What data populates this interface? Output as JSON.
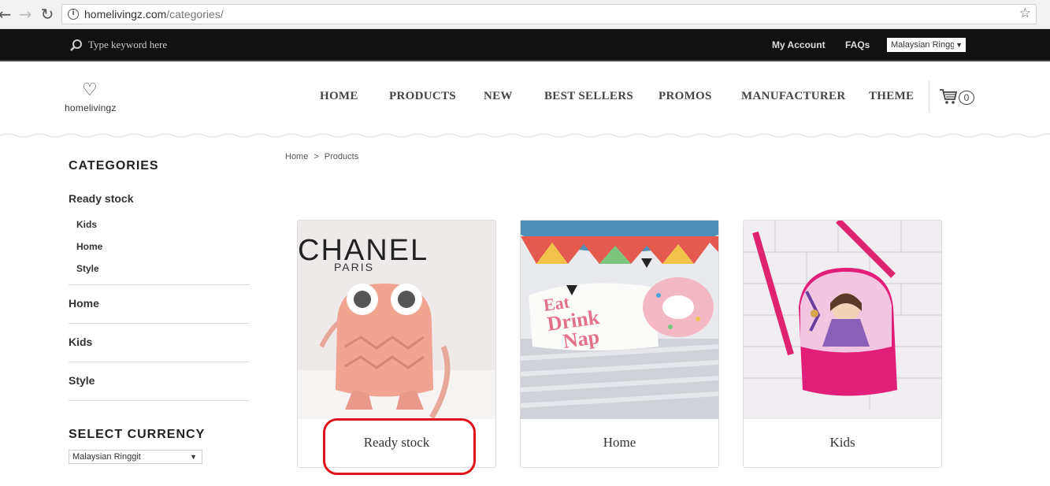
{
  "browser": {
    "url_host": "homelivingz.com",
    "url_path": "/categories/"
  },
  "topbar": {
    "search_placeholder": "Type keyword here",
    "my_account": "My Account",
    "faqs": "FAQs",
    "currency_value": "Malaysian Ringgit"
  },
  "header": {
    "logo_text": "homelivingz",
    "menu": [
      "HOME",
      "PRODUCTS",
      "NEW",
      "BEST SELLERS",
      "PROMOS",
      "MANUFACTURER",
      "THEME"
    ],
    "cart_count": "0"
  },
  "sidebar": {
    "categories_title": "CATEGORIES",
    "ready_stock": "Ready stock",
    "sub_items": [
      "Kids",
      "Home",
      "Style"
    ],
    "items": [
      "Home",
      "Kids",
      "Style"
    ],
    "currency_title": "SELECT CURRENCY",
    "currency_value": "Malaysian Ringgit"
  },
  "breadcrumb": {
    "home": "Home",
    "separator": ">",
    "current": "Products"
  },
  "products": [
    {
      "label": "Ready stock"
    },
    {
      "label": "Home"
    },
    {
      "label": "Kids"
    }
  ],
  "colors": {
    "topbar_bg": "#111111",
    "highlight": "#e0121a"
  }
}
